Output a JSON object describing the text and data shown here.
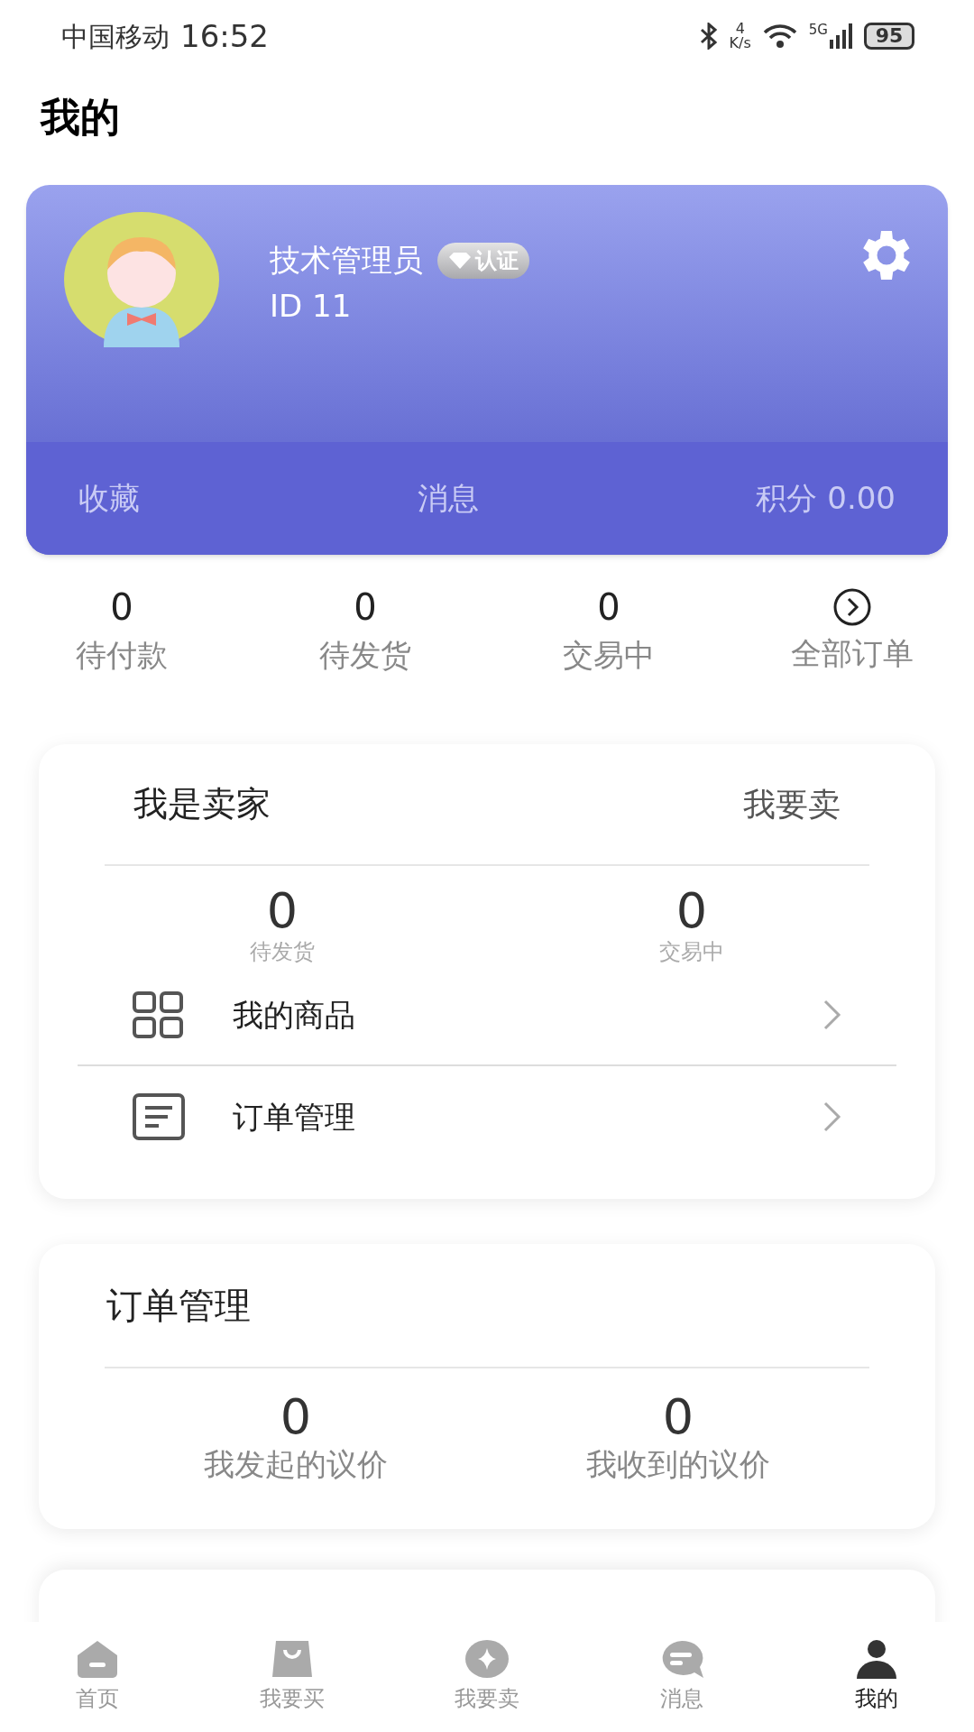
{
  "status_bar": {
    "carrier": "中国移动",
    "time": "16:52",
    "speed_value": "4",
    "speed_unit": "K/s",
    "network": "5G",
    "battery": "95"
  },
  "page_title": "我的",
  "profile": {
    "name": "技术管理员",
    "badge": "认证",
    "id": "ID 11",
    "links": [
      {
        "label": "收藏"
      },
      {
        "label": "消息"
      },
      {
        "label": "积分 0.00"
      }
    ]
  },
  "order_summary": [
    {
      "kind": "count",
      "value": "0",
      "label": "待付款"
    },
    {
      "kind": "count",
      "value": "0",
      "label": "待发货"
    },
    {
      "kind": "count",
      "value": "0",
      "label": "交易中"
    },
    {
      "kind": "link",
      "label": "全部订单"
    }
  ],
  "seller": {
    "title": "我是卖家",
    "action": "我要卖",
    "stats": [
      {
        "value": "0",
        "label": "待发货"
      },
      {
        "value": "0",
        "label": "交易中"
      }
    ],
    "menu": [
      {
        "kind": "grid",
        "label": "我的商品"
      },
      {
        "kind": "list",
        "label": "订单管理"
      }
    ]
  },
  "bargain": {
    "title": "订单管理",
    "stats": [
      {
        "value": "0",
        "label": "我发起的议价"
      },
      {
        "value": "0",
        "label": "我收到的议价"
      }
    ]
  },
  "tab_bar": [
    {
      "kind": "home",
      "label": "首页",
      "selected": false
    },
    {
      "kind": "bag",
      "label": "我要买",
      "selected": false
    },
    {
      "kind": "diamond",
      "label": "我要卖",
      "selected": false
    },
    {
      "kind": "chat",
      "label": "消息",
      "selected": false
    },
    {
      "kind": "person",
      "label": "我的",
      "selected": true
    }
  ]
}
